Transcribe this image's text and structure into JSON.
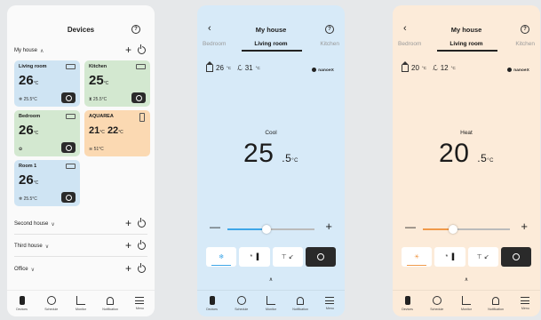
{
  "devices_screen": {
    "title": "Devices",
    "houses": [
      {
        "name": "My house",
        "expanded": true
      },
      {
        "name": "Second house",
        "expanded": false
      },
      {
        "name": "Third house",
        "expanded": false
      },
      {
        "name": "Office",
        "expanded": false
      }
    ],
    "rooms": [
      {
        "name": "Living room",
        "temp": "26",
        "unit": "°C",
        "sub": "❄ 25.5°C"
      },
      {
        "name": "Kitchen",
        "temp": "25",
        "unit": "°C",
        "sub": "⧗ 25.5°C"
      },
      {
        "name": "Bedroom",
        "temp": "26",
        "unit": "°C",
        "sub": "✿"
      },
      {
        "name": "AQUAREA",
        "temp_a": "21",
        "temp_b": "22",
        "unit": "°C",
        "sub": "≋ 51°C"
      },
      {
        "name": "Room 1",
        "temp": "26",
        "unit": "°C",
        "sub": "❄ 25.5°C"
      }
    ]
  },
  "cool_screen": {
    "title": "My house",
    "tabs": {
      "left": "Bedroom",
      "active": "Living room",
      "right": "Kitchen"
    },
    "indoor": "26",
    "outdoor": "31",
    "unit": "°C",
    "brand": "nanoeX",
    "mode": "Cool",
    "setpoint_int": "25",
    "setpoint_dec": ".5",
    "slider_level": 0.45,
    "accent": "#3ea6e8"
  },
  "heat_screen": {
    "title": "My house",
    "tabs": {
      "left": "Bedroom",
      "active": "Living room",
      "right": "Kitchen"
    },
    "indoor": "20",
    "outdoor": "12",
    "unit": "°C",
    "brand": "nanoeX",
    "mode": "Heat",
    "setpoint_int": "20",
    "setpoint_dec": ".5",
    "slider_level": 0.35,
    "accent": "#f09a4a"
  },
  "nav": [
    "Devices",
    "Schedule",
    "Monitor",
    "Notification",
    "Menu"
  ],
  "symbols": {
    "plus": "+",
    "minus": "—",
    "chevron_down": "∨",
    "chevron_up": "∧",
    "back": "‹",
    "help": "?"
  }
}
